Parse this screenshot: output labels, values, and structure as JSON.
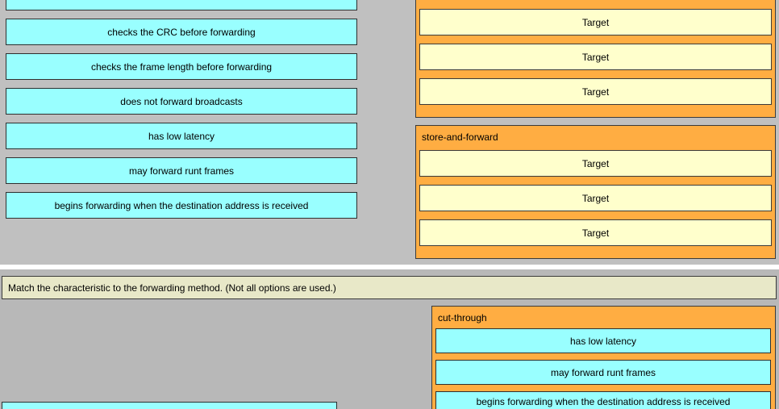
{
  "top": {
    "items": [
      "checks the CRC before forwarding",
      "checks the frame length before forwarding",
      "does not forward broadcasts",
      "has low latency",
      "may forward runt frames",
      "begins forwarding when the destination address is received"
    ],
    "group_cut_through": {
      "targets": [
        "Target",
        "Target",
        "Target"
      ]
    },
    "group_store_and_forward": {
      "title": "store-and-forward",
      "targets": [
        "Target",
        "Target",
        "Target"
      ]
    }
  },
  "bottom": {
    "instruction": "Match the characteristic to the forwarding method. (Not all options are used.)",
    "group_cut_through": {
      "title": "cut-through",
      "answers": [
        "has low latency",
        "may forward runt frames",
        "begins forwarding when the destination address is received"
      ]
    }
  }
}
